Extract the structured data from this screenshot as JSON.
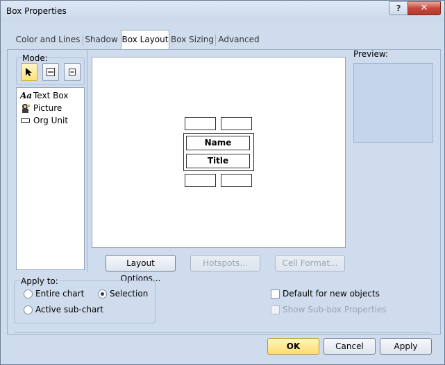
{
  "window": {
    "title": "Box Properties",
    "help_label": "?",
    "close_label": "✕"
  },
  "tabs": [
    {
      "label": "Color and Lines",
      "active": false
    },
    {
      "label": "Shadow",
      "active": false
    },
    {
      "label": "Box Layout",
      "active": true
    },
    {
      "label": "Box Sizing",
      "active": false
    },
    {
      "label": "Advanced",
      "active": false
    }
  ],
  "mode": {
    "label": "Mode:",
    "buttons": [
      {
        "icon": "pointer-arrow-icon",
        "selected": true
      },
      {
        "icon": "split-box-icon",
        "selected": false
      },
      {
        "icon": "minus-box-icon",
        "selected": false
      }
    ]
  },
  "items": [
    {
      "label": "Text Box",
      "icon": "text-box-icon",
      "glyph": "Aa"
    },
    {
      "label": "Picture",
      "icon": "picture-icon",
      "glyph": ""
    },
    {
      "label": "Org Unit",
      "icon": "org-unit-icon",
      "glyph": ""
    }
  ],
  "canvas": {
    "name_label": "Name",
    "title_label": "Title"
  },
  "preview": {
    "label": "Preview:"
  },
  "buttons": {
    "layout_options": "Layout Options...",
    "hotspots": "Hotspots...",
    "cell_format": "Cell Format..."
  },
  "apply_to": {
    "label": "Apply to:",
    "options": [
      {
        "label": "Entire chart",
        "selected": false
      },
      {
        "label": "Selection",
        "selected": true
      },
      {
        "label": "Active sub-chart",
        "selected": false
      }
    ]
  },
  "checkboxes": [
    {
      "label": "Default for new objects",
      "checked": false,
      "enabled": true
    },
    {
      "label": "Show Sub-box Properties",
      "checked": false,
      "enabled": false
    }
  ],
  "footer": {
    "ok": "OK",
    "cancel": "Cancel",
    "apply": "Apply"
  }
}
